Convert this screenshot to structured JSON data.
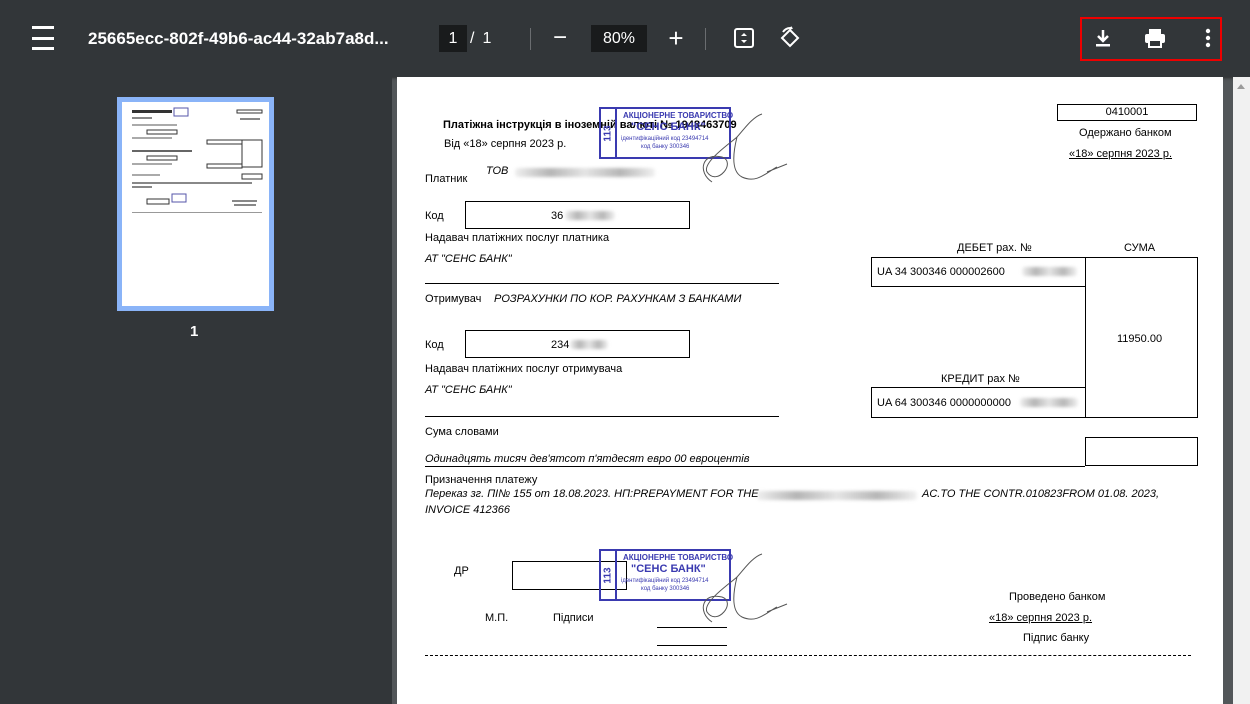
{
  "toolbar": {
    "title": "25665ecc-802f-49b6-ac44-32ab7a8d...",
    "current_page": "1",
    "page_separator": "/",
    "total_pages": "1",
    "zoom_out": "−",
    "zoom_value": "80%",
    "zoom_in": "+"
  },
  "thumbnail": {
    "page_number": "1"
  },
  "document": {
    "header_title": "Платіжна інструкція в іноземній валюті №",
    "doc_number": "1948463709",
    "date_line": "Від «18» серпня 2023 р.",
    "form_code": "0410001",
    "received_by_bank": "Одержано банком",
    "received_date": "«18» серпня 2023 р.",
    "payer_label": "Платник",
    "payer_name": "ТОВ",
    "code_label": "Код",
    "payer_code": "36",
    "payer_provider_label": "Надавач платіжних послуг платника",
    "payer_bank": "АТ \"СЕНС БАНК\"",
    "debit_label": "ДЕБЕТ рах. №",
    "sum_label": "СУМА",
    "debit_account": "UA 34 300346 000002600",
    "receiver_label": "Отримувач",
    "receiver_name": "РОЗРАХУНКИ ПО КОР. РАХУНКАМ З БАНКАМИ",
    "receiver_code": "234",
    "amount": "11950.00",
    "receiver_provider_label": "Надавач платіжних послуг отримувача",
    "receiver_bank": "АТ \"СЕНС БАНК\"",
    "credit_label": "КРЕДИТ рах №",
    "credit_account": "UA 64 300346 0000000000",
    "sum_words_label": "Сума словами",
    "sum_words": "Одинадцять тисяч дев'ятсот п'ятдесят  евро 00 евроцентів",
    "purpose_label": "Призначення платежу",
    "purpose_line1_a": "Переказ зг. ПІ№ 155 от 18.08.2023. НП:PREPAYMENT FOR THE",
    "purpose_line1_b": "AC.TO THE CONTR.010823FROM 01.08.  2023,",
    "purpose_line2": "INVOICE 412366",
    "dr_label": "ДР",
    "mp_label": "М.П.",
    "signatures_label": "Підписи",
    "processed_by_bank": "Проведено банком",
    "processed_date": "«18» серпня 2023 р.",
    "bank_signature": "Підпис банку"
  },
  "stamp": {
    "number": "113",
    "line1": "АКЦІОНЕРНЕ ТОВАРИСТВО",
    "line2": "\"СЕНС БАНК\"",
    "line3": "ідентифікаційний код 23494714",
    "line4": "код банку 300346"
  }
}
